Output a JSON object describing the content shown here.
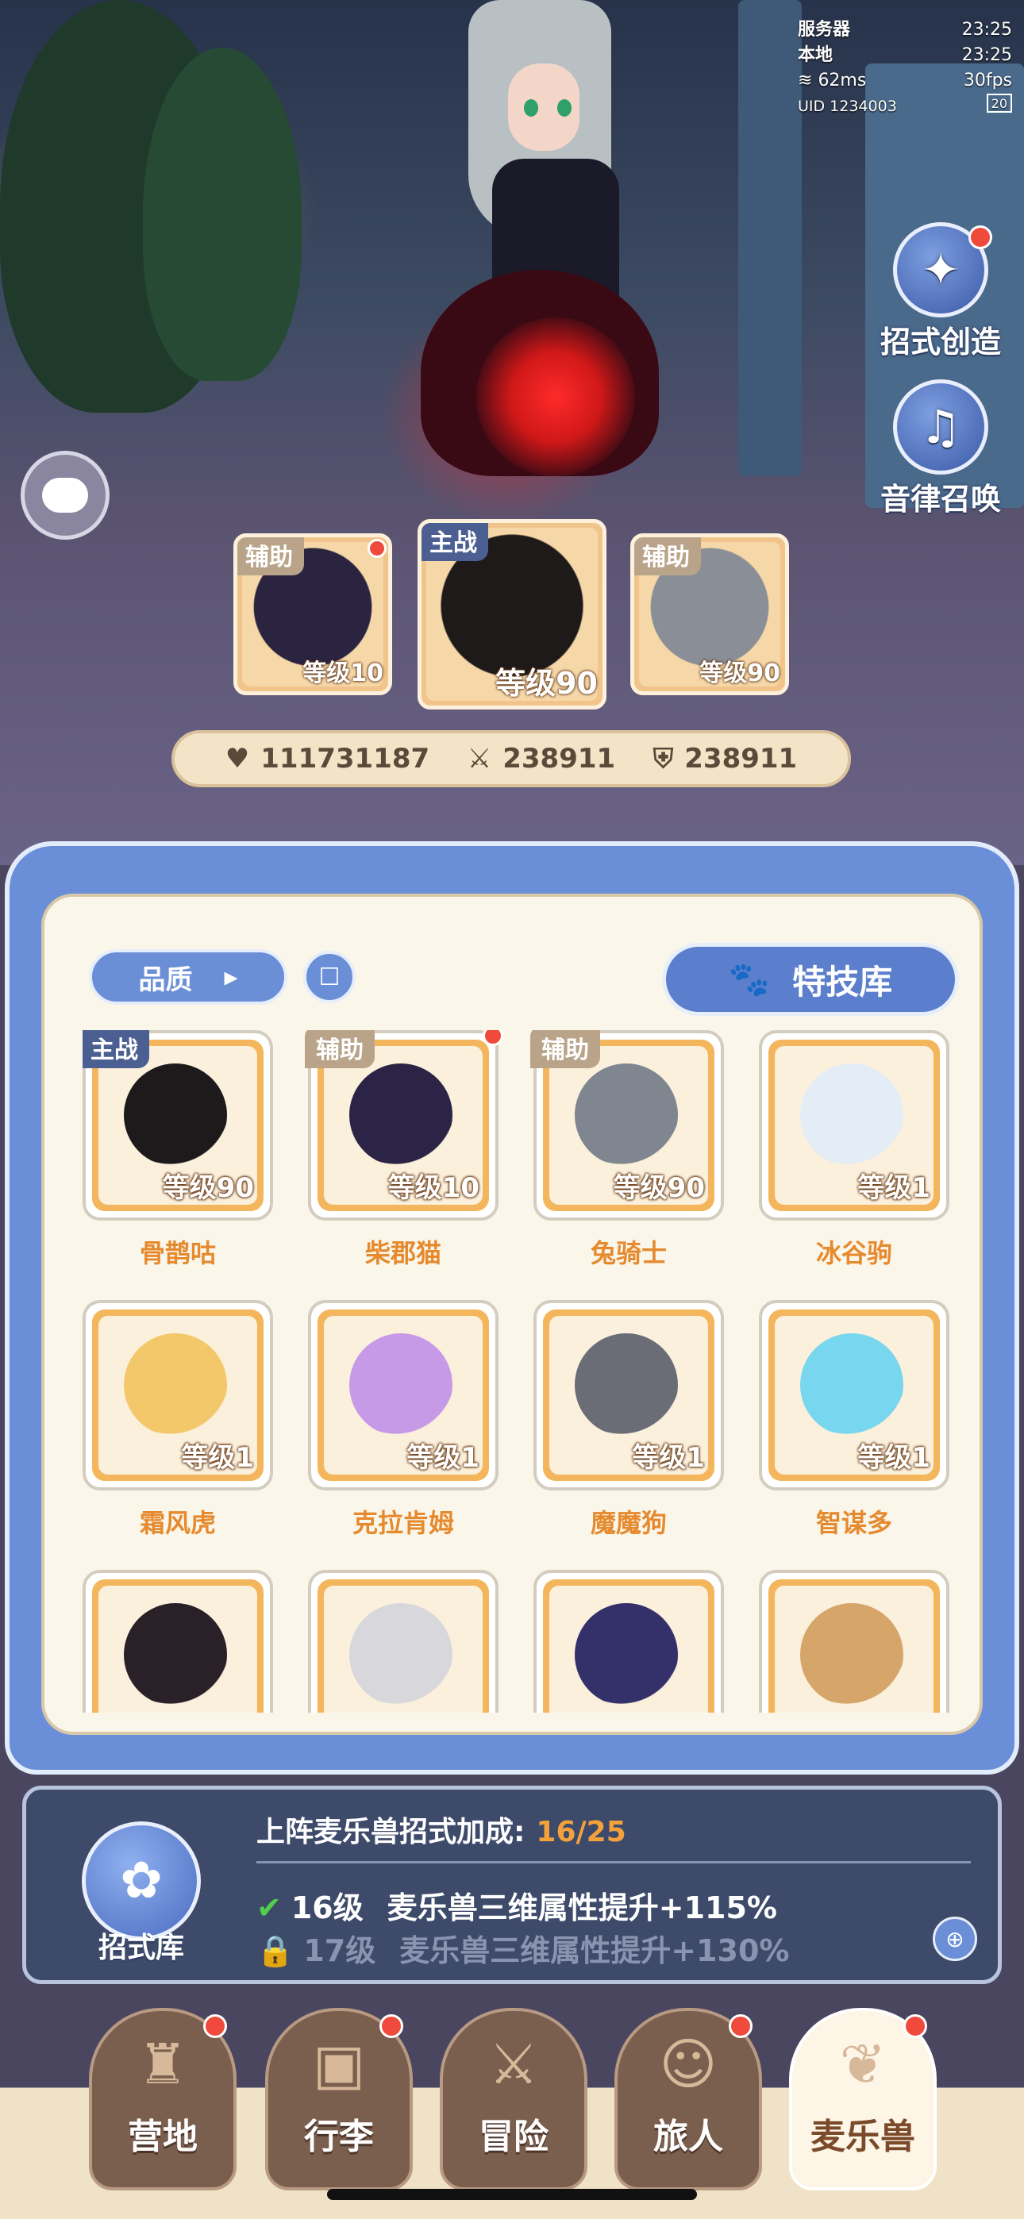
{
  "status": {
    "server_label": "服务器",
    "server_time": "23:25",
    "local_label": "本地",
    "local_time": "23:25",
    "ping": "62ms",
    "fps": "30fps",
    "uid": "UID 1234003",
    "badge": "20"
  },
  "side_buttons": [
    {
      "label": "招式创造",
      "icon": "cat-crown-icon",
      "has_dot": true
    },
    {
      "label": "音律召唤",
      "icon": "lyre-icon",
      "has_dot": false
    }
  ],
  "team": [
    {
      "tag": "辅助",
      "level": "等级10",
      "color": "#2a2440"
    },
    {
      "tag": "主战",
      "level": "等级90",
      "color": "#1e1a1a"
    },
    {
      "tag": "辅助",
      "level": "等级90",
      "color": "#8a8e96"
    }
  ],
  "stats": {
    "hp": "111731187",
    "atk": "238911",
    "def": "238911"
  },
  "filter": {
    "label": "品质",
    "arrow": "▸",
    "book": "☐",
    "skill_lib": "特技库"
  },
  "pets": [
    {
      "name": "骨鹊咕",
      "level": "等级90",
      "tag": "主战",
      "tag_type": "main",
      "color": "#1d1a1c",
      "dot": false
    },
    {
      "name": "柴郡猫",
      "level": "等级10",
      "tag": "辅助",
      "tag_type": "sub",
      "color": "#2b2446",
      "dot": true
    },
    {
      "name": "兔骑士",
      "level": "等级90",
      "tag": "辅助",
      "tag_type": "sub",
      "color": "#7f8690",
      "dot": false
    },
    {
      "name": "冰谷驹",
      "level": "等级1",
      "tag": "",
      "tag_type": "",
      "color": "#e4ecf6",
      "dot": false
    },
    {
      "name": "霜风虎",
      "level": "等级1",
      "tag": "",
      "tag_type": "",
      "color": "#f3c86a",
      "dot": false
    },
    {
      "name": "克拉肯姆",
      "level": "等级1",
      "tag": "",
      "tag_type": "",
      "color": "#c79ae8",
      "dot": false
    },
    {
      "name": "魔魔狗",
      "level": "等级1",
      "tag": "",
      "tag_type": "",
      "color": "#6a6c76",
      "dot": false
    },
    {
      "name": "智谋多",
      "level": "等级1",
      "tag": "",
      "tag_type": "",
      "color": "#78d6ee",
      "dot": false
    },
    {
      "name": "",
      "level": "",
      "tag": "",
      "tag_type": "",
      "color": "#2a2028",
      "dot": false
    },
    {
      "name": "",
      "level": "",
      "tag": "",
      "tag_type": "",
      "color": "#d8d8dc",
      "dot": false
    },
    {
      "name": "",
      "level": "",
      "tag": "",
      "tag_type": "",
      "color": "#34306a",
      "dot": false
    },
    {
      "name": "",
      "level": "",
      "tag": "",
      "tag_type": "",
      "color": "#d6a56a",
      "dot": false
    }
  ],
  "bonus": {
    "library_label": "招式库",
    "title": "上阵麦乐兽招式加成:",
    "count": "16/25",
    "done_level": "16级",
    "done_desc": "麦乐兽三维属性提升+115%",
    "next_level": "17级",
    "next_desc": "麦乐兽三维属性提升+130%"
  },
  "nav": [
    {
      "label": "营地",
      "icon": "castle-icon",
      "dot": true,
      "active": false
    },
    {
      "label": "行李",
      "icon": "backpack-icon",
      "dot": true,
      "active": false
    },
    {
      "label": "冒险",
      "icon": "swords-icon",
      "dot": false,
      "active": false
    },
    {
      "label": "旅人",
      "icon": "traveler-icon",
      "dot": true,
      "active": false
    },
    {
      "label": "麦乐兽",
      "icon": "pet-icon",
      "dot": true,
      "active": true
    }
  ]
}
